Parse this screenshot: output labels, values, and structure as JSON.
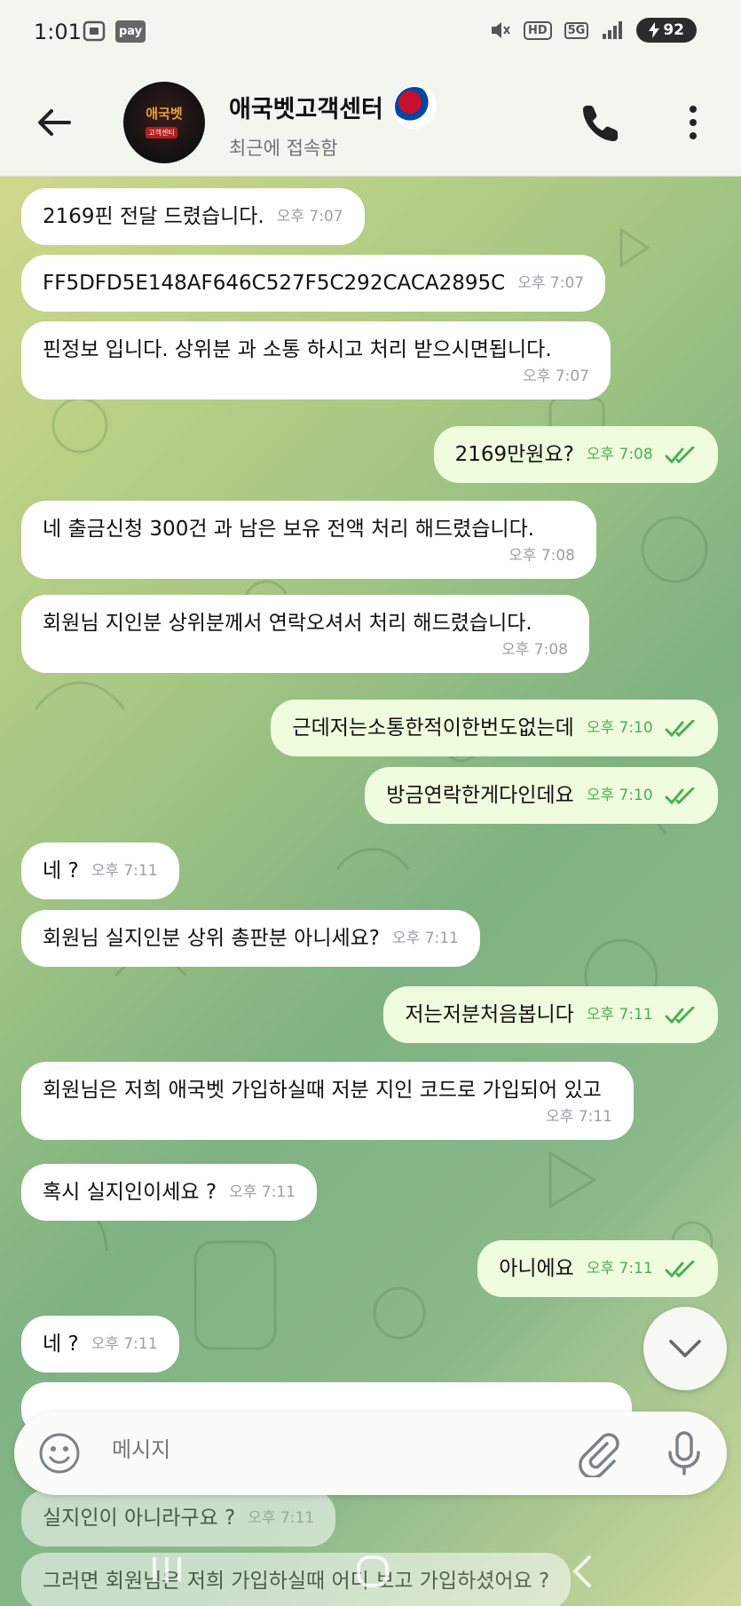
{
  "status": {
    "time": "1:01",
    "pay": "pay",
    "hd": "HD",
    "network": "5G",
    "battery": "92"
  },
  "header": {
    "title": "애국벳고객센터",
    "subtitle": "최근에 접속함",
    "avatar_text": "애국벳",
    "avatar_sub": "고객센터"
  },
  "messages": [
    {
      "dir": "in",
      "text": "2169핀 전달 드렸습니다.",
      "time": "오후 7:07"
    },
    {
      "dir": "in",
      "text": "FF5DFD5E148AF646C527F5C292CACA2895C",
      "time": "오후 7:07"
    },
    {
      "dir": "in",
      "text": "핀정보 입니다. 상위분 과 소통 하시고 처리 받으시면됩니다.",
      "time": "오후 7:07"
    },
    {
      "dir": "out",
      "text": "2169만원요?",
      "time": "오후 7:08"
    },
    {
      "dir": "in",
      "text": "네 출금신청 300건 과 남은 보유 전액 처리 해드렸습니다.",
      "time": "오후 7:08"
    },
    {
      "dir": "in",
      "text": "회원님 지인분 상위분께서 연락오셔서 처리 해드렸습니다.",
      "time": "오후 7:08"
    },
    {
      "dir": "out",
      "text": "근데저는소통한적이한번도없는데",
      "time": "오후 7:10"
    },
    {
      "dir": "out",
      "text": "방금연락한게다인데요",
      "time": "오후 7:10"
    },
    {
      "dir": "in",
      "text": "네 ?",
      "time": "오후 7:11"
    },
    {
      "dir": "in",
      "text": "회원님 실지인분 상위 총판분 아니세요?",
      "time": "오후 7:11"
    },
    {
      "dir": "out",
      "text": "저는저분처음봅니다",
      "time": "오후 7:11"
    },
    {
      "dir": "in",
      "text": "회원님은 저희 애국벳 가입하실때 저분 지인 코드로 가입되어 있고",
      "time": "오후 7:11"
    },
    {
      "dir": "in",
      "text": "혹시 실지인이세요 ?",
      "time": "오후 7:11"
    },
    {
      "dir": "out",
      "text": "아니에요",
      "time": "오후 7:11"
    },
    {
      "dir": "in",
      "text": "네 ?",
      "time": "오후 7:11"
    },
    {
      "dir": "in",
      "text": "실지인이 아니라구요 ?",
      "time": "오후 7:11"
    },
    {
      "dir": "in",
      "text": "그러면 회원님은 저희 가입하실때 어디 보고 가입하셨어요 ?",
      "time": ""
    }
  ],
  "input": {
    "placeholder": "메시지"
  },
  "colors": {
    "incoming_bubble": "#ffffff",
    "outgoing_bubble": "#effdde",
    "read_check": "#4caf50",
    "header_bg": "#f3f6ef"
  },
  "icons": [
    "back-arrow-icon",
    "phone-icon",
    "more-vert-icon",
    "emoji-icon",
    "attach-icon",
    "mic-icon",
    "chevron-down-icon"
  ]
}
